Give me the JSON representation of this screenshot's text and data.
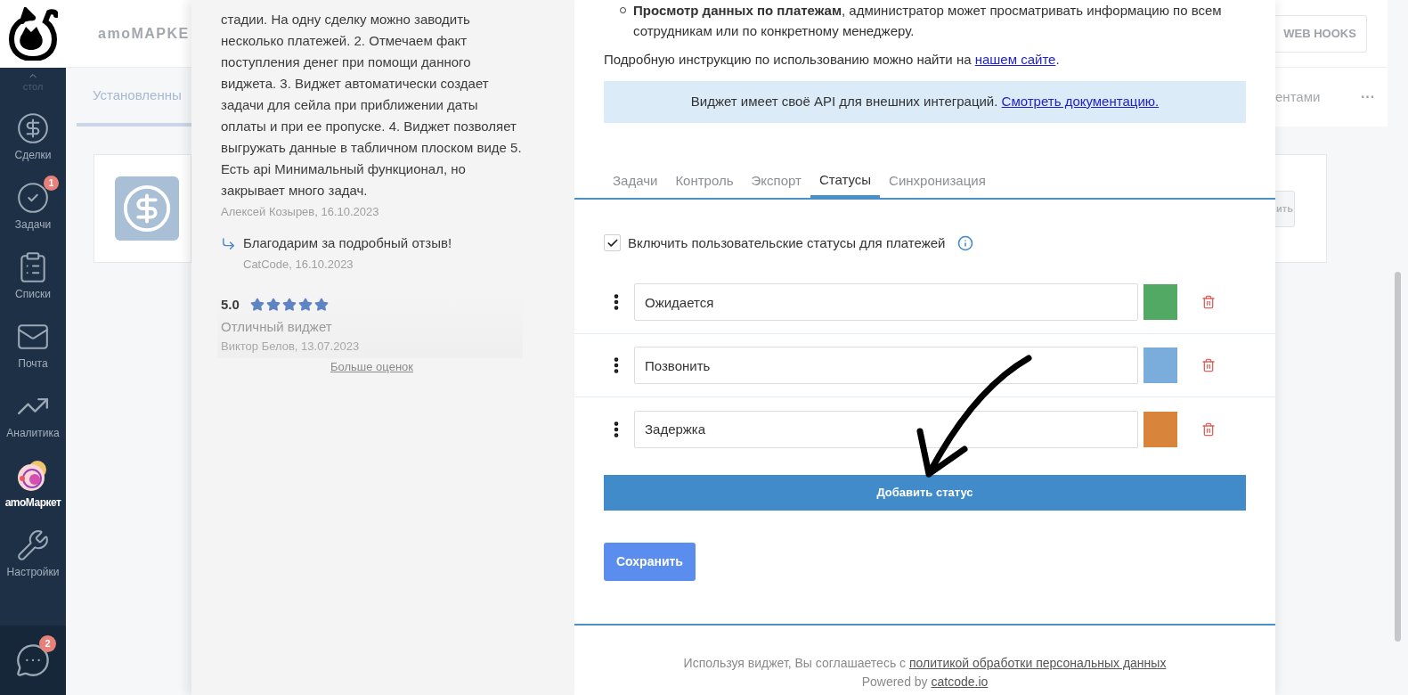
{
  "nav": {
    "top_label": "стол",
    "items": [
      {
        "label": "Сделки",
        "kind": "deals",
        "selected": false
      },
      {
        "label": "Задачи",
        "kind": "tasks",
        "selected": false,
        "badge": "1"
      },
      {
        "label": "Списки",
        "kind": "lists",
        "selected": false
      },
      {
        "label": "Почта",
        "kind": "mail",
        "selected": false
      },
      {
        "label": "Аналитика",
        "kind": "analytics",
        "selected": false
      },
      {
        "label": "amoМаркет",
        "kind": "market",
        "selected": true
      },
      {
        "label": "Настройки",
        "kind": "settings",
        "selected": false
      }
    ],
    "chat_badge": "2"
  },
  "background": {
    "brand": "amoMAPKE",
    "tab_left": "Установленны",
    "webhooks_button": "WEB HOOKS",
    "tab_right": "ентами",
    "more": "···",
    "card_button": "ить"
  },
  "review": {
    "text": "стадии. На одну сделку можно заводить несколько платежей. 2. Отмечаем факт поступления денег при помощи данного виджета. 3. Виджет автоматически создает задачи для сейла при приближении даты оплаты и при ее пропуске. 4. Виджет позволяет выгружать данные в табличном плоском виде 5. Есть api Минимальный функционал, но закрывает много задач.",
    "author": "Алексей Козырев, 16.10.2023",
    "reply": {
      "text": "Благодарим за подробный отзыв!",
      "author": "CatCode, 16.10.2023"
    },
    "next": {
      "score": "5.0",
      "stars": 5,
      "title": "Отличный виджет",
      "author": "Виктор Белов, 13.07.2023"
    },
    "more_link": "Больше оценок"
  },
  "details": {
    "bullet": "**Просмотр данных по платежам**, администратор может просматривать информацию по всем сотрудникам или по конкретному менеджеру.",
    "instruction": {
      "text": "Подробную инструкцию по использованию можно найти на ",
      "link": "нашем сайте",
      "end": "."
    },
    "notice": {
      "text": "Виджет имеет своё API для внешних интеграций. ",
      "link": "Смотреть документацию."
    },
    "tabs": [
      {
        "label": "Задачи",
        "selected": false
      },
      {
        "label": "Контроль",
        "selected": false
      },
      {
        "label": "Экспорт",
        "selected": false
      },
      {
        "label": "Статусы",
        "selected": true
      },
      {
        "label": "Синхронизация",
        "selected": false
      }
    ],
    "custom_statuses": {
      "label": "Включить пользовательские статусы для платежей",
      "checked": true
    },
    "statuses": [
      {
        "name": "Ожидается",
        "color": "#52a963"
      },
      {
        "name": "Позвонить",
        "color": "#7aaddc"
      },
      {
        "name": "Задержка",
        "color": "#d8843a"
      }
    ],
    "add_button": "Добавить статус",
    "save_button": "Сохранить",
    "footer": {
      "text": "Используя виджет, Вы соглашаетесь с ",
      "link": "политикой обработки персональных данных",
      "powered": "Powered by ",
      "powered_link": "catcode.io"
    }
  }
}
